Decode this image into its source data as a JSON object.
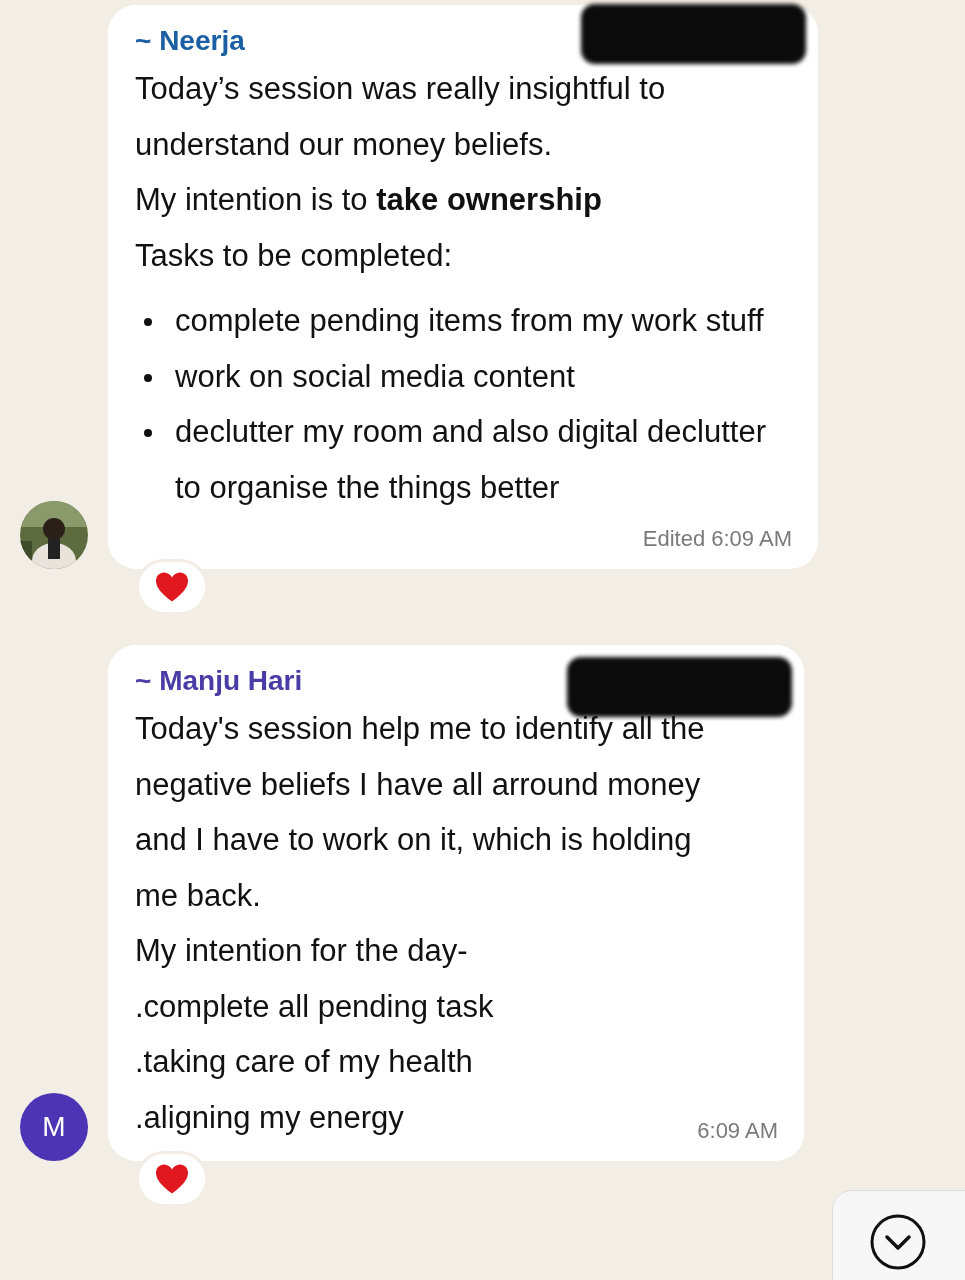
{
  "messages": [
    {
      "sender": "~ Neerja",
      "color": "#1b5ea3",
      "number_redacted": true,
      "body": [
        {
          "kind": "text",
          "text": "Today’s session was really insightful to understand our money beliefs."
        },
        {
          "kind": "text",
          "text": "My intention is to **take ownership**"
        },
        {
          "kind": "text",
          "text": "Tasks to be completed:"
        },
        {
          "kind": "bullet",
          "text": "complete pending items from my work stuff"
        },
        {
          "kind": "bullet",
          "text": "work on social media content"
        },
        {
          "kind": "bullet",
          "text": "declutter my room and also digital declutter to organise the things better"
        }
      ],
      "time": "Edited 6:09 AM",
      "reaction": {
        "kind": "heart"
      }
    },
    {
      "sender": "~ Manju Hari",
      "color": "#4a3ca6",
      "number_redacted": true,
      "avatar": {
        "kind": "initial",
        "text": "M",
        "color": "#4b35b5"
      },
      "body": [
        {
          "kind": "text",
          "text": "Today's session help me to identify all the negative beliefs I have all arround money and I have to work on it, which is holding me back."
        },
        {
          "kind": "text",
          "text": "My intention for the day-"
        },
        {
          "kind": "text",
          "text": ".complete all pending task"
        },
        {
          "kind": "text",
          "text": ".taking care of my health"
        },
        {
          "kind": "text",
          "text": ".aligning my energy"
        }
      ],
      "time": "6:09 AM",
      "reaction": {
        "kind": "heart"
      }
    }
  ]
}
